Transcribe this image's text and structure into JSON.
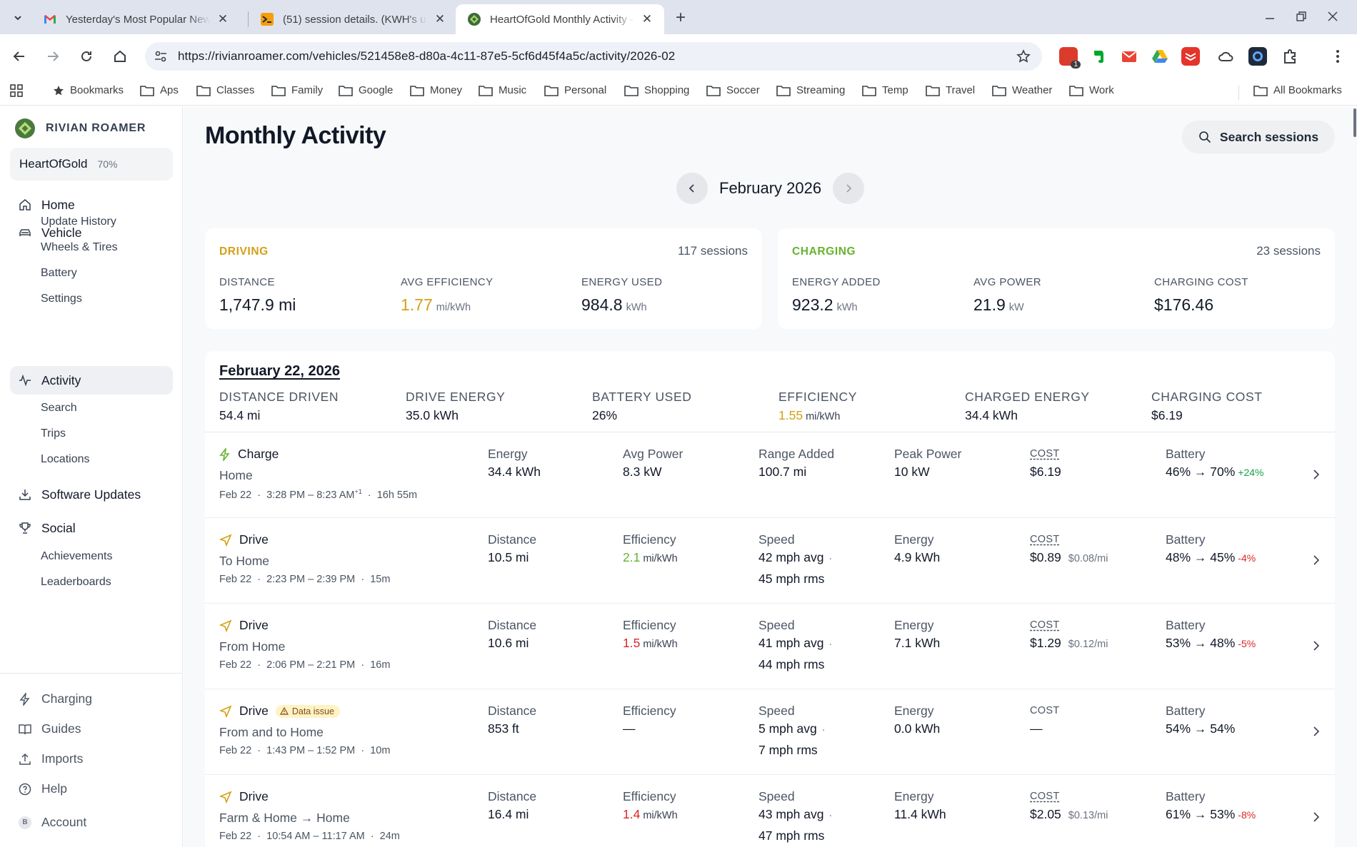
{
  "browser": {
    "tabs": [
      {
        "title": "Yesterday's Most Popular New"
      },
      {
        "title": "(51) session details. (KWH's us"
      },
      {
        "title": "HeartOfGold Monthly Activity –"
      }
    ],
    "url": "https://rivianroamer.com/vehicles/521458e8-d80a-4c11-87e5-5cf6d45f4a5c/activity/2026-02",
    "extension_badge": "1",
    "bookmarks": [
      "Bookmarks",
      "Aps",
      "Classes",
      "Family",
      "Google",
      "Money",
      "Music",
      "Personal",
      "Shopping",
      "Soccer",
      "Streaming",
      "Temp",
      "Travel",
      "Weather",
      "Work"
    ],
    "all_bookmarks": "All Bookmarks"
  },
  "sidebar": {
    "brand": "RIVIAN ROAMER",
    "vehicle": {
      "name": "HeartOfGold",
      "battery": "70%"
    },
    "nav": {
      "home": "Home",
      "vehicle": "Vehicle",
      "update_history": "Update History",
      "wheels_tires": "Wheels & Tires",
      "battery": "Battery",
      "settings": "Settings",
      "activity": "Activity",
      "search": "Search",
      "trips": "Trips",
      "locations": "Locations",
      "software_updates": "Software Updates",
      "social": "Social",
      "achievements": "Achievements",
      "leaderboards": "Leaderboards"
    },
    "bottom": {
      "charging": "Charging",
      "guides": "Guides",
      "imports": "Imports",
      "help": "Help",
      "account_initial": "B",
      "account": "Account"
    }
  },
  "main": {
    "title": "Monthly Activity",
    "search_label": "Search sessions",
    "month": "February 2026",
    "driving": {
      "title": "DRIVING",
      "sessions": "117 sessions",
      "distance_label": "DISTANCE",
      "distance": "1,747.9 mi",
      "efficiency_label": "AVG EFFICIENCY",
      "efficiency": "1.77",
      "efficiency_unit": "mi/kWh",
      "energy_label": "ENERGY USED",
      "energy": "984.8",
      "energy_unit": "kWh"
    },
    "charging": {
      "title": "CHARGING",
      "sessions": "23 sessions",
      "energy_label": "ENERGY ADDED",
      "energy": "923.2",
      "energy_unit": "kWh",
      "power_label": "AVG POWER",
      "power": "21.9",
      "power_unit": "kW",
      "cost_label": "CHARGING COST",
      "cost": "$176.46"
    },
    "day": {
      "date": "February 22, 2026",
      "distance_label": "DISTANCE DRIVEN",
      "distance": "54.4 mi",
      "drive_energy_label": "DRIVE ENERGY",
      "drive_energy": "35.0 kWh",
      "battery_label": "BATTERY USED",
      "battery": "26%",
      "efficiency_label": "EFFICIENCY",
      "efficiency": "1.55",
      "efficiency_unit": "mi/kWh",
      "charged_label": "CHARGED ENERGY",
      "charged": "34.4 kWh",
      "cost_label": "CHARGING COST",
      "cost": "$6.19"
    },
    "sessions": [
      {
        "type": "Charge",
        "place": "Home",
        "date": "Feb 22",
        "time": "3:28 PM – 8:23 AM",
        "time_sup": "+1",
        "duration": "16h 55m",
        "c1_label": "Energy",
        "c1": "34.4 kWh",
        "c2_label": "Avg Power",
        "c2": "8.3 kW",
        "c3_label": "Range Added",
        "c3": "100.7 mi",
        "c4_label": "Peak Power",
        "c4": "10 kW",
        "cost_label": "COST",
        "cost": "$6.19",
        "battery_label": "Battery",
        "battery": "46% → 70%",
        "battery_delta": "+24%"
      },
      {
        "type": "Drive",
        "place": "To Home",
        "date": "Feb 22",
        "time": "2:23 PM – 2:39 PM",
        "duration": "15m",
        "c1_label": "Distance",
        "c1": "10.5 mi",
        "c2_label": "Efficiency",
        "c2": "2.1",
        "c2_unit": "mi/kWh",
        "c3_label": "Speed",
        "c3": "42 mph avg",
        "c3b": "45 mph rms",
        "c4_label": "Energy",
        "c4": "4.9 kWh",
        "cost_label": "COST",
        "cost": "$0.89",
        "cost_per": "$0.08/mi",
        "battery_label": "Battery",
        "battery": "48% → 45%",
        "battery_delta": "-4%"
      },
      {
        "type": "Drive",
        "place": "From Home",
        "date": "Feb 22",
        "time": "2:06 PM – 2:21 PM",
        "duration": "16m",
        "c1_label": "Distance",
        "c1": "10.6 mi",
        "c2_label": "Efficiency",
        "c2": "1.5",
        "c2_unit": "mi/kWh",
        "c3_label": "Speed",
        "c3": "41 mph avg",
        "c3b": "44 mph rms",
        "c4_label": "Energy",
        "c4": "7.1 kWh",
        "cost_label": "COST",
        "cost": "$1.29",
        "cost_per": "$0.12/mi",
        "battery_label": "Battery",
        "battery": "53% → 48%",
        "battery_delta": "-5%"
      },
      {
        "type": "Drive",
        "badge": "Data issue",
        "place": "From and to Home",
        "date": "Feb 22",
        "time": "1:43 PM – 1:52 PM",
        "duration": "10m",
        "c1_label": "Distance",
        "c1": "853 ft",
        "c2_label": "Efficiency",
        "c2": "—",
        "c3_label": "Speed",
        "c3": "5 mph avg",
        "c3b": "7 mph rms",
        "c4_label": "Energy",
        "c4": "0.0 kWh",
        "cost_label": "COST",
        "cost": "—",
        "battery_label": "Battery",
        "battery": "54% → 54%"
      },
      {
        "type": "Drive",
        "place": "Farm & Home → Home",
        "date": "Feb 22",
        "time": "10:54 AM – 11:17 AM",
        "duration": "24m",
        "c1_label": "Distance",
        "c1": "16.4 mi",
        "c2_label": "Efficiency",
        "c2": "1.4",
        "c2_unit": "mi/kWh",
        "c3_label": "Speed",
        "c3": "43 mph avg",
        "c3b": "47 mph rms",
        "c4_label": "Energy",
        "c4": "11.4 kWh",
        "cost_label": "COST",
        "cost": "$2.05",
        "cost_per": "$0.13/mi",
        "battery_label": "Battery",
        "battery": "61% → 53%",
        "battery_delta": "-8%"
      }
    ],
    "separator_dot": "·",
    "colors": {
      "driving_accent": "#d4a017",
      "charging_accent": "#65b32e",
      "positive": "#16a34a",
      "negative": "#dc2626"
    }
  }
}
